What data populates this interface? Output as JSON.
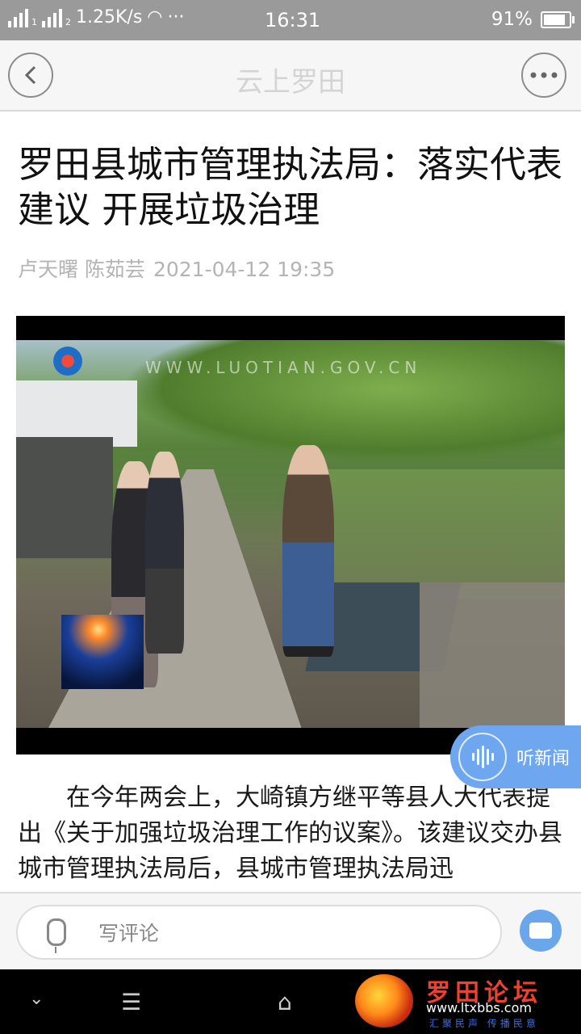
{
  "status_bar": {
    "sim1": "1",
    "sim2": "2",
    "network_speed": "1.25K/s",
    "dots": "···",
    "time": "16:31",
    "battery": "91%"
  },
  "header": {
    "title": "云上罗田",
    "back_icon": "chevron-left-icon",
    "more_icon": "more-dots-icon"
  },
  "article": {
    "headline": "罗田县城市管理执法局：落实代表建议 开展垃圾治理",
    "authors": "卢天曙 陈茹芸",
    "datetime": "2021-04-12 19:35",
    "image_watermark": "WWW.LUOTIAN.GOV.CN",
    "body": "在今年两会上，大崎镇方继平等县人大代表提出《关于加强垃圾治理工作的议案》。该建议交办县城市管理执法局后，县城市管理执法局迅"
  },
  "listen_button": {
    "label": "听新闻",
    "icon": "audio-wave-icon"
  },
  "comment_bar": {
    "placeholder": "写评论",
    "mic_icon": "microphone-icon",
    "chat_icon": "comment-bubble-icon"
  },
  "nav_bar": {
    "down_icon": "chevron-down-icon",
    "menu_icon": "menu-icon",
    "home_icon": "home-icon"
  },
  "forum_logo": {
    "title": "罗田论坛",
    "url": "www.ltxbbs.com",
    "slogan": "汇聚民声 传播民意"
  }
}
